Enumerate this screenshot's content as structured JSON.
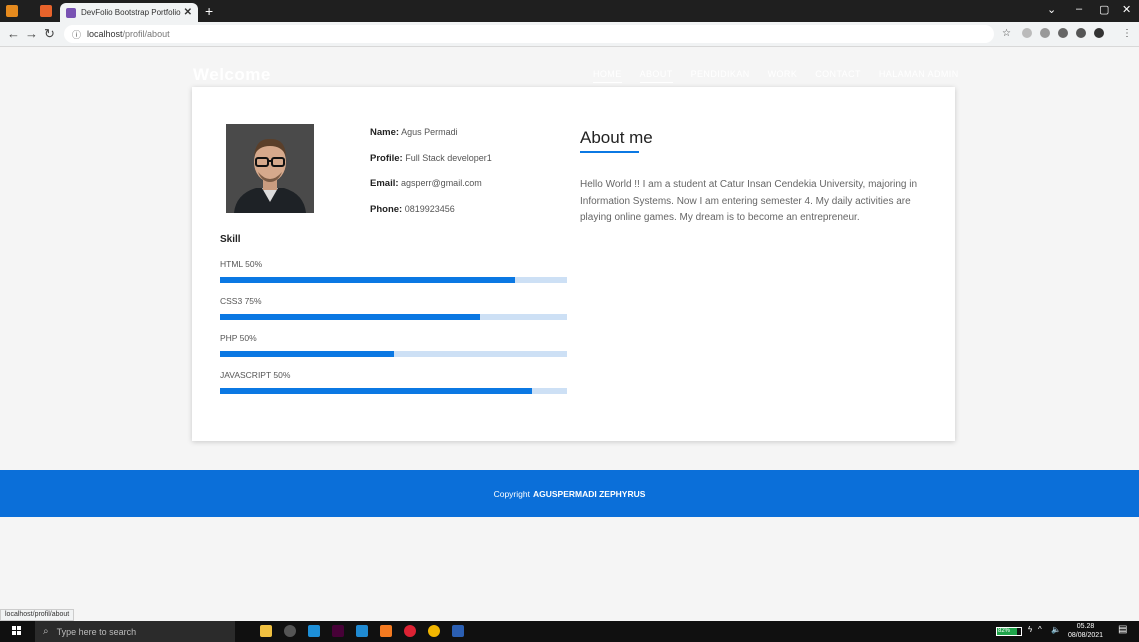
{
  "browser": {
    "tab_title": "DevFolio Bootstrap Portfolio Tem",
    "tab_close": "✕",
    "new_tab": "+",
    "url_host": "localhost",
    "url_path": "/profil/about",
    "status_url": "localhost/profil/about"
  },
  "navbar": {
    "brand": "Welcome",
    "items": [
      "HOME",
      "ABOUT",
      "PENDIDIKAN",
      "WORK",
      "CONTACT",
      "HALAMAN ADMIN"
    ],
    "active_index": 1
  },
  "profile": {
    "name_label": "Name:",
    "name": "Agus Permadi",
    "profile_label": "Profile:",
    "profile": "Full Stack developer1",
    "email_label": "Email:",
    "email": "agsperr@gmail.com",
    "phone_label": "Phone:",
    "phone": "0819923456"
  },
  "skills": {
    "title": "Skill",
    "items": [
      {
        "label": "HTML 50%",
        "level": 0.85
      },
      {
        "label": "CSS3 75%",
        "level": 0.75
      },
      {
        "label": "PHP 50%",
        "level": 0.5
      },
      {
        "label": "JAVASCRIPT 50%",
        "level": 0.9
      }
    ]
  },
  "about": {
    "title": "About me",
    "text": "Hello World !! I am a student at Catur Insan Cendekia University, majoring in Information Systems. Now I am entering semester 4. My daily activities are playing online games. My dream is to become an entrepreneur."
  },
  "footer": {
    "prefix": "Copyright",
    "owner": "AGUSPERMADI ZEPHYRUS"
  },
  "taskbar": {
    "search_placeholder": "Type here to search",
    "battery": "82%",
    "time": "05.28",
    "date": "08/08/2021"
  },
  "colors": {
    "accent": "#0b78e3",
    "footer": "#0b6fd9",
    "track": "#cde0f5"
  }
}
